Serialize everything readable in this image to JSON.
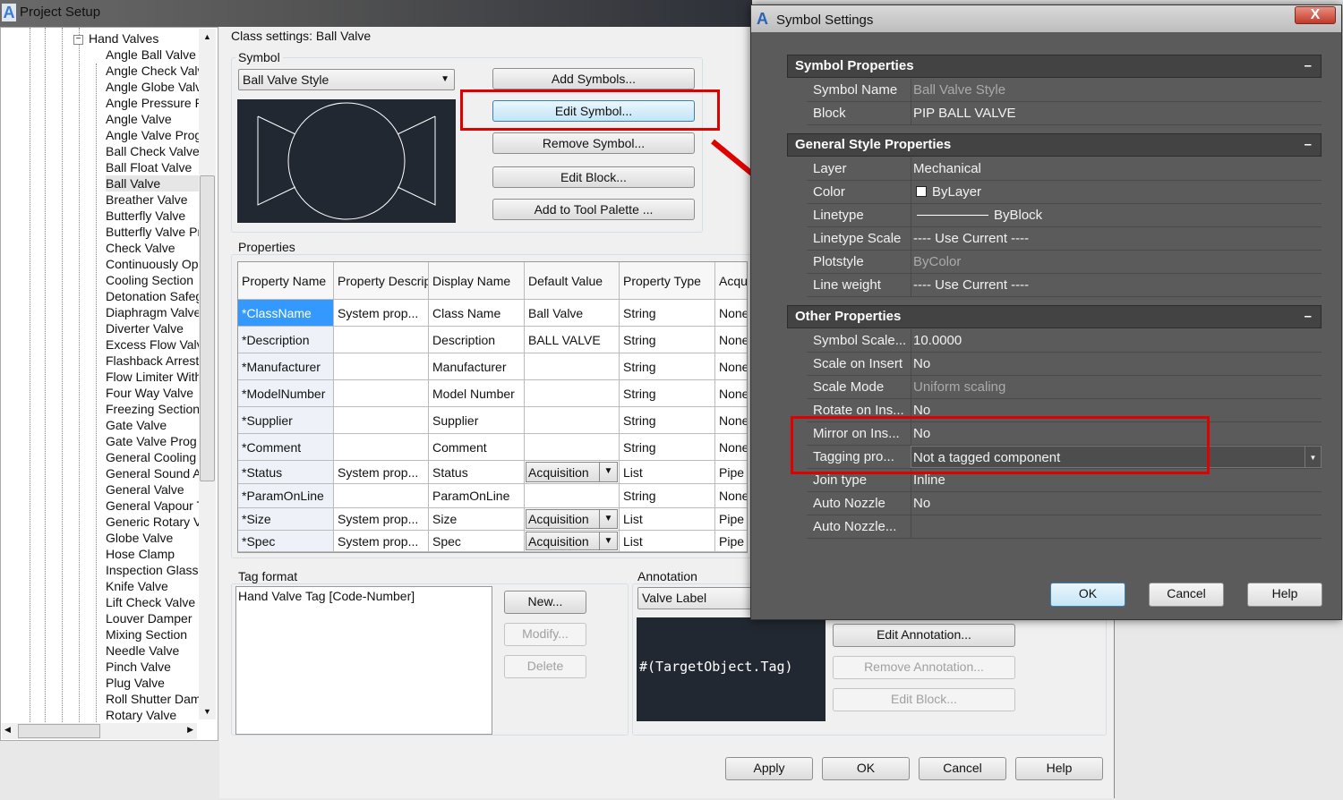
{
  "window": {
    "title": "Project Setup"
  },
  "tree": {
    "parent": "Hand Valves",
    "items": [
      "Angle Ball Valve",
      "Angle Check Valve",
      "Angle Globe Valve",
      "Angle Pressure Relief",
      "Angle Valve",
      "Angle Valve Prog",
      "Ball Check Valve",
      "Ball Float Valve",
      "Ball Valve",
      "Breather Valve",
      "Butterfly Valve",
      "Butterfly Valve Prog",
      "Check Valve",
      "Continuously Operated",
      "Cooling Section",
      "Detonation Safeguard",
      "Diaphragm Valve",
      "Diverter Valve",
      "Excess Flow Valve",
      "Flashback Arrester",
      "Flow Limiter With",
      "Four Way Valve",
      "Freezing Section",
      "Gate Valve",
      "Gate Valve Prog",
      "General Cooling",
      "General Sound Absorber",
      "General Valve",
      "General Vapour Trap",
      "Generic Rotary Valve",
      "Globe Valve",
      "Hose Clamp",
      "Inspection Glass",
      "Knife Valve",
      "Lift Check Valve",
      "Louver Damper",
      "Mixing Section",
      "Needle Valve",
      "Pinch Valve",
      "Plug Valve",
      "Roll Shutter Damper",
      "Rotary Valve"
    ],
    "selected": "Ball Valve"
  },
  "class_settings": "Class settings: Ball Valve",
  "symbol": {
    "label": "Symbol",
    "style": "Ball Valve Style",
    "buttons": [
      "Add Symbols...",
      "Edit Symbol...",
      "Remove Symbol...",
      "Edit Block...",
      "Add to Tool Palette ..."
    ]
  },
  "properties": {
    "label": "Properties",
    "headers": [
      "Property Name",
      "Property Description",
      "Display Name",
      "Default Value",
      "Property Type",
      "Acquisition"
    ],
    "rows": [
      [
        "*ClassName",
        "System prop...",
        "Class Name",
        "Ball Valve",
        "String",
        "None"
      ],
      [
        "*Description",
        "",
        "Description",
        "BALL VALVE",
        "String",
        "None"
      ],
      [
        "*Manufacturer",
        "",
        "Manufacturer",
        "",
        "String",
        "None"
      ],
      [
        "*ModelNumber",
        "",
        "Model Number",
        "",
        "String",
        "None"
      ],
      [
        "*Supplier",
        "",
        "Supplier",
        "",
        "String",
        "None"
      ],
      [
        "*Comment",
        "",
        "Comment",
        "",
        "String",
        "None"
      ],
      [
        "*Status",
        "System prop...",
        "Status",
        "Acquisition",
        "List",
        "Pipe"
      ],
      [
        "*ParamOnLine",
        "",
        "ParamOnLine",
        "",
        "String",
        "None"
      ],
      [
        "*Size",
        "System prop...",
        "Size",
        "Acquisition",
        "List",
        "Pipe"
      ],
      [
        "*Spec",
        "System prop...",
        "Spec",
        "Acquisition",
        "List",
        "Pipe"
      ]
    ]
  },
  "tag_format": {
    "label": "Tag format",
    "items": [
      "Hand Valve Tag [Code-Number]"
    ],
    "buttons": [
      "New...",
      "Modify...",
      "Delete"
    ]
  },
  "annotation": {
    "label": "Annotation",
    "value": "Valve Label",
    "preview": "#(TargetObject.Tag)",
    "buttons": [
      "Edit Annotation...",
      "Remove Annotation...",
      "Edit Block..."
    ]
  },
  "footer": {
    "buttons": [
      "Apply",
      "OK",
      "Cancel",
      "Help"
    ]
  },
  "dialog": {
    "title": "Symbol Settings",
    "close": "X",
    "sections": [
      {
        "title": "Symbol Properties",
        "rows": [
          [
            "Symbol Name",
            "Ball Valve Style"
          ],
          [
            "Block",
            "PIP BALL VALVE"
          ]
        ]
      },
      {
        "title": "General Style Properties",
        "rows": [
          [
            "Layer",
            "Mechanical"
          ],
          [
            "Color",
            "ByLayer"
          ],
          [
            "Linetype",
            "ByBlock"
          ],
          [
            "Linetype Scale",
            "---- Use Current ----"
          ],
          [
            "Plotstyle",
            "ByColor"
          ],
          [
            "Line weight",
            "---- Use Current ----"
          ]
        ]
      },
      {
        "title": "Other Properties",
        "rows": [
          [
            "Symbol Scale...",
            "10.0000"
          ],
          [
            "Scale on Insert",
            "No"
          ],
          [
            "Scale Mode",
            "Uniform scaling"
          ],
          [
            "Rotate on Ins...",
            "No"
          ],
          [
            "Mirror on Ins...",
            "No"
          ],
          [
            "Tagging pro...",
            "Not a tagged component"
          ],
          [
            "Join type",
            "Inline"
          ],
          [
            "Auto Nozzle",
            "No"
          ],
          [
            "Auto Nozzle...",
            ""
          ]
        ]
      }
    ],
    "collapse": "–",
    "buttons": [
      "OK",
      "Cancel",
      "Help"
    ]
  },
  "colors": {
    "highlight": "#e00000",
    "selection": "#3399ff"
  }
}
